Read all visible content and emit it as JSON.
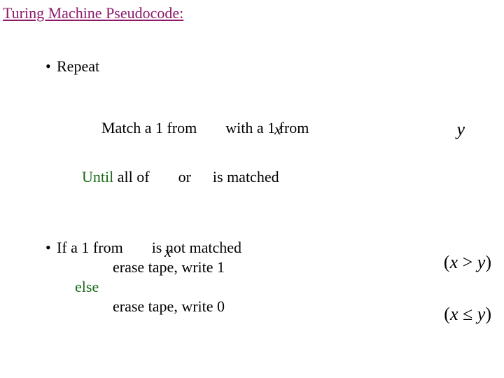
{
  "title": "Turing Machine Pseudocode:",
  "bullets": {
    "repeat": "Repeat",
    "match_a": "Match a 1 from",
    "match_b": "with a 1 from",
    "until": "Until",
    "all_of": " all  of",
    "or": "or",
    "is_matched": "is matched",
    "if_line": "If a 1 from",
    "not_matched": "is not matched",
    "erase1": "erase tape, write 1",
    "else": "else",
    "erase0": "erase tape, write 0"
  },
  "math": {
    "x": "x",
    "y": "y",
    "gt": "(x > y)",
    "le": "(x ≤ y)"
  }
}
